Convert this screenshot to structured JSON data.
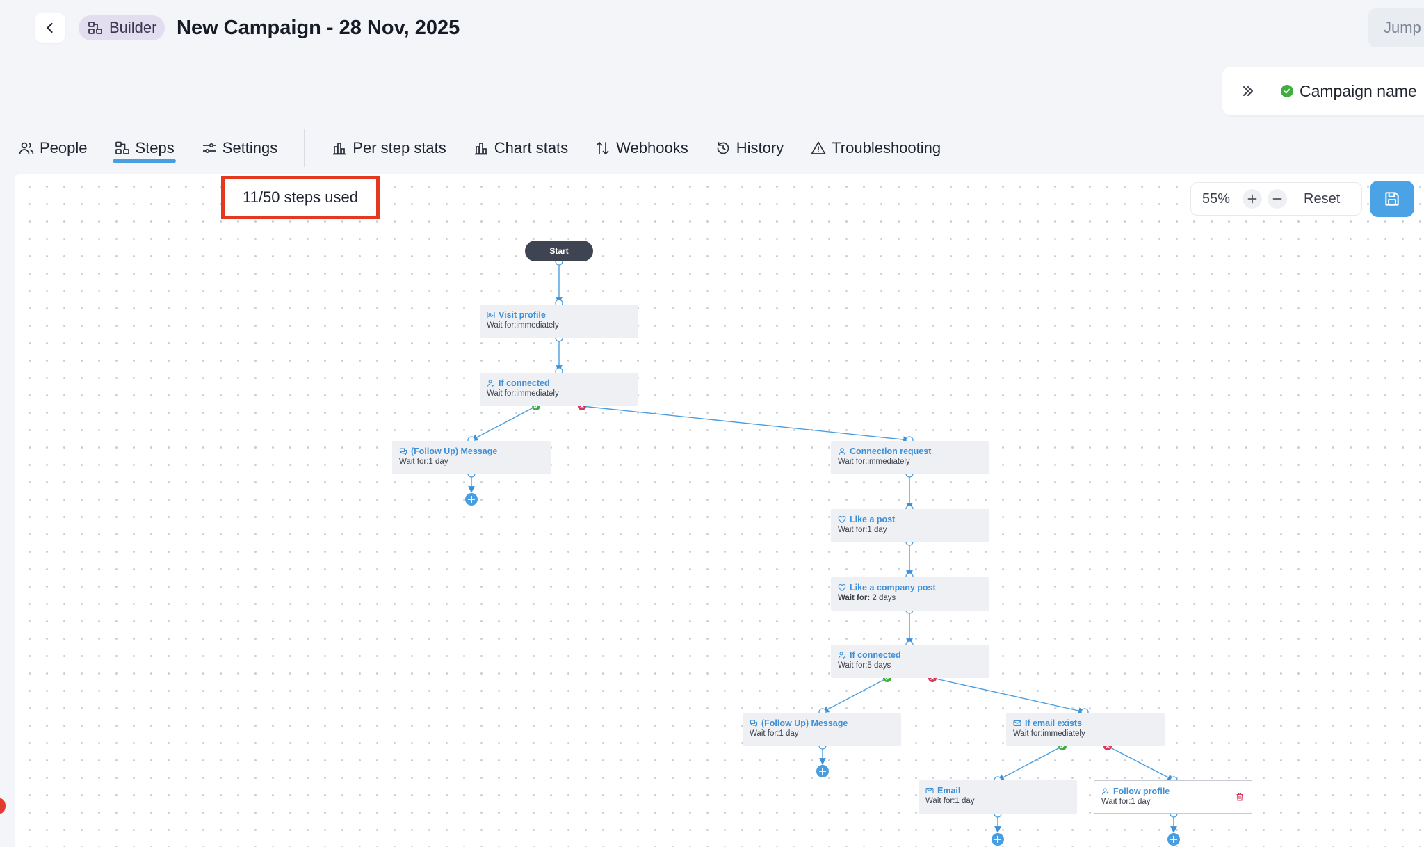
{
  "header": {
    "builder_label": "Builder",
    "title": "New Campaign - 28 Nov, 2025",
    "jump_label": "Jump t"
  },
  "panel": {
    "campaign_name_label": "Campaign name"
  },
  "tabs": [
    {
      "label": "People",
      "icon": "people-icon"
    },
    {
      "label": "Steps",
      "icon": "steps-icon",
      "active": true
    },
    {
      "label": "Settings",
      "icon": "settings-icon"
    },
    {
      "label": "Per step stats",
      "icon": "bar-chart-icon"
    },
    {
      "label": "Chart stats",
      "icon": "bar-chart-icon"
    },
    {
      "label": "Webhooks",
      "icon": "arrows-updown-icon"
    },
    {
      "label": "History",
      "icon": "history-icon"
    },
    {
      "label": "Troubleshooting",
      "icon": "warning-icon"
    }
  ],
  "canvas": {
    "steps_used": "11/50 steps used",
    "zoom": "55%",
    "reset_label": "Reset",
    "start_label": "Start",
    "steps": [
      {
        "title": "Visit profile",
        "wait": "Wait for:immediately",
        "icon": "visit-profile-icon"
      },
      {
        "title": "If connected",
        "wait": "Wait for:immediately",
        "icon": "person-check-icon"
      },
      {
        "title": "(Follow Up) Message",
        "wait": "Wait for:1 day",
        "icon": "message-icon"
      },
      {
        "title": "Connection request",
        "wait": "Wait for:immediately",
        "icon": "person-icon"
      },
      {
        "title": "Like a post",
        "wait": "Wait for:1 day",
        "icon": "heart-icon"
      },
      {
        "title": "Like a company post",
        "wait_label": "Wait for:",
        "wait_value": " 2 days",
        "icon": "heart-icon"
      },
      {
        "title": "If connected",
        "wait": "Wait for:5 days",
        "icon": "person-check-icon"
      },
      {
        "title": "(Follow Up) Message",
        "wait": "Wait for:1 day",
        "icon": "message-icon"
      },
      {
        "title": "If email exists",
        "wait": "Wait for:immediately",
        "icon": "email-check-icon"
      },
      {
        "title": "Email",
        "wait": "Wait for:1 day",
        "icon": "email-icon"
      },
      {
        "title": "Follow profile",
        "wait": "Wait for:1 day",
        "icon": "person-plus-icon"
      }
    ]
  },
  "colors": {
    "accent": "#4a9ee0",
    "link": "#3d8fd8",
    "success": "#3fae3f",
    "danger": "#d9365e",
    "highlight": "#e5391f"
  }
}
